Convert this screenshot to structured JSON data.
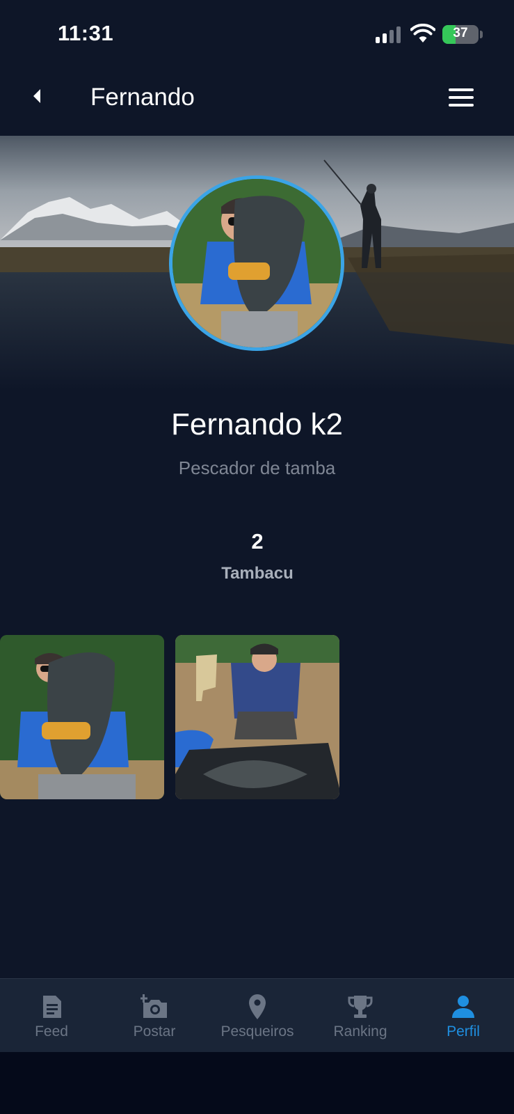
{
  "status_bar": {
    "time": "11:31",
    "battery": "37",
    "battery_level": 0.37,
    "signal_bars": 2
  },
  "nav": {
    "title": "Fernando",
    "back_icon": "chevron-left-icon",
    "menu_icon": "hamburger-menu-icon"
  },
  "profile": {
    "name": "Fernando k2",
    "bio": "Pescador de tamba",
    "stats": [
      {
        "count": "2",
        "label": "Tambacu"
      }
    ]
  },
  "posts": [
    {
      "name": "post-photo-man-holding-fish"
    },
    {
      "name": "post-photo-man-with-fish-on-ground"
    }
  ],
  "tabs": [
    {
      "label": "Feed",
      "icon": "document-icon",
      "active": false
    },
    {
      "label": "Postar",
      "icon": "add-camera-icon",
      "active": false
    },
    {
      "label": "Pesqueiros",
      "icon": "map-pin-icon",
      "active": false
    },
    {
      "label": "Ranking",
      "icon": "trophy-icon",
      "active": false
    },
    {
      "label": "Perfil",
      "icon": "person-icon",
      "active": true
    }
  ],
  "colors": {
    "background": "#0e1628",
    "accent": "#1f8fe0",
    "avatar_ring": "#3ba4e6",
    "inactive": "#6b7585"
  }
}
